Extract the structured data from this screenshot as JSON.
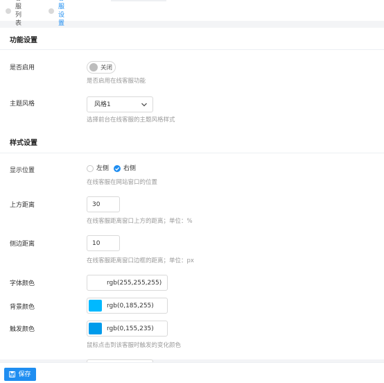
{
  "tabs": [
    {
      "label": "客服列表",
      "active": false
    },
    {
      "label": "客服设置",
      "active": true
    }
  ],
  "function_section": {
    "title": "功能设置",
    "enable": {
      "label": "是否启用",
      "toggle_text": "关闭",
      "enabled": false,
      "hint": "是否启用在线客服功能"
    },
    "theme": {
      "label": "主题风格",
      "value": "风格1",
      "hint": "选择前台在线客服的主题风格样式"
    }
  },
  "style_section": {
    "title": "样式设置",
    "position": {
      "label": "显示位置",
      "options": [
        "左侧",
        "右侧"
      ],
      "selected": "右侧",
      "hint": "在线客服在网站窗口的位置"
    },
    "top_distance": {
      "label": "上方距离",
      "value": "30",
      "hint": "在线客服距离窗口上方的距离；单位：%"
    },
    "side_distance": {
      "label": "侧边距离",
      "value": "10",
      "hint": "在线客服距离窗口边框的距离；单位：px"
    },
    "font_color": {
      "label": "字体颜色",
      "value": "rgb(255,255,255)",
      "swatch": "#ffffff"
    },
    "bg_color": {
      "label": "背景颜色",
      "value": "rgb(0,185,255)",
      "swatch": "#00b9ff"
    },
    "trigger_color": {
      "label": "触发颜色",
      "value": "rgb(0,155,235)",
      "swatch": "#009beb",
      "hint": "鼠标点击到该客服时触发的变化颜色"
    }
  },
  "footer": {
    "save_label": "保存"
  },
  "colors": {
    "accent": "#1f8ef1"
  }
}
